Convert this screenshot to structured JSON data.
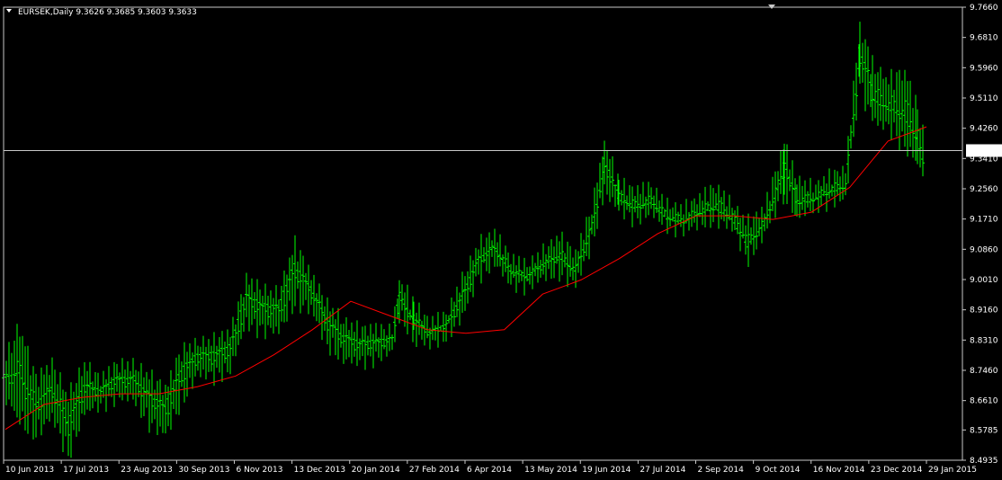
{
  "header": {
    "symbol_timeframe": "EURSEK,Daily",
    "ohlc": "9.3626 9.3685 9.3603 9.3633"
  },
  "colors": {
    "background": "#000000",
    "frame": "#c8c8c8",
    "bars": "#00ff00",
    "moving_average": "#ff0000",
    "price_line": "#c8c8c8",
    "price_label_bg": "#ffffff",
    "price_label_text": "#000000"
  },
  "chart_data": {
    "type": "bar",
    "ylim": [
      8.4935,
      9.766
    ],
    "yticks": [
      "9.7660",
      "9.6810",
      "9.5960",
      "9.5110",
      "9.4260",
      "9.3410",
      "9.2560",
      "9.1710",
      "9.0860",
      "9.0010",
      "8.9160",
      "8.8310",
      "8.7460",
      "8.6610",
      "8.5785",
      "8.4935"
    ],
    "xticks": [
      "10 Jun 2013",
      "17 Jul 2013",
      "23 Aug 2013",
      "30 Sep 2013",
      "6 Nov 2013",
      "13 Dec 2013",
      "20 Jan 2014",
      "27 Feb 2014",
      "6 Apr 2014",
      "13 May 2014",
      "19 Jun 2014",
      "27 Jul 2014",
      "2 Sep 2014",
      "9 Oct 2014",
      "16 Nov 2014",
      "23 Dec 2014",
      "29 Jan 2015"
    ],
    "current_price": "9.3633",
    "current_price_value": 9.3633,
    "series": [
      {
        "type": "ohlc",
        "points": [
          {
            "i": 0,
            "low": 8.68,
            "high": 8.77
          },
          {
            "i": 18,
            "low": 8.61,
            "high": 8.86
          },
          {
            "i": 36,
            "low": 8.57,
            "high": 8.72
          },
          {
            "i": 54,
            "low": 8.62,
            "high": 8.76
          },
          {
            "i": 72,
            "low": 8.51,
            "high": 8.67
          },
          {
            "i": 90,
            "low": 8.63,
            "high": 8.76
          },
          {
            "i": 108,
            "low": 8.65,
            "high": 8.72
          },
          {
            "i": 126,
            "low": 8.67,
            "high": 8.76
          },
          {
            "i": 144,
            "low": 8.67,
            "high": 8.76
          },
          {
            "i": 162,
            "low": 8.6,
            "high": 8.73
          },
          {
            "i": 180,
            "low": 8.57,
            "high": 8.69
          },
          {
            "i": 198,
            "low": 8.66,
            "high": 8.8
          },
          {
            "i": 216,
            "low": 8.74,
            "high": 8.82
          },
          {
            "i": 234,
            "low": 8.73,
            "high": 8.83
          },
          {
            "i": 252,
            "low": 8.75,
            "high": 8.85
          },
          {
            "i": 270,
            "low": 8.88,
            "high": 9.0
          },
          {
            "i": 288,
            "low": 8.86,
            "high": 8.97
          },
          {
            "i": 306,
            "low": 8.86,
            "high": 8.96
          },
          {
            "i": 324,
            "low": 8.94,
            "high": 9.1
          },
          {
            "i": 342,
            "low": 8.92,
            "high": 9.01
          },
          {
            "i": 360,
            "low": 8.82,
            "high": 8.93
          },
          {
            "i": 378,
            "low": 8.78,
            "high": 8.88
          },
          {
            "i": 396,
            "low": 8.77,
            "high": 8.86
          },
          {
            "i": 414,
            "low": 8.78,
            "high": 8.86
          },
          {
            "i": 432,
            "low": 8.8,
            "high": 8.86
          },
          {
            "i": 440,
            "low": 8.9,
            "high": 9.0
          },
          {
            "i": 456,
            "low": 8.84,
            "high": 8.93
          },
          {
            "i": 474,
            "low": 8.82,
            "high": 8.88
          },
          {
            "i": 492,
            "low": 8.84,
            "high": 8.9
          },
          {
            "i": 510,
            "low": 8.9,
            "high": 9.0
          },
          {
            "i": 528,
            "low": 9.01,
            "high": 9.1
          },
          {
            "i": 546,
            "low": 9.05,
            "high": 9.13
          },
          {
            "i": 564,
            "low": 8.99,
            "high": 9.06
          },
          {
            "i": 582,
            "low": 8.98,
            "high": 9.04
          },
          {
            "i": 600,
            "low": 9.01,
            "high": 9.08
          },
          {
            "i": 618,
            "low": 9.02,
            "high": 9.12
          },
          {
            "i": 636,
            "low": 8.99,
            "high": 9.07
          },
          {
            "i": 654,
            "low": 9.1,
            "high": 9.2
          },
          {
            "i": 668,
            "low": 9.25,
            "high": 9.39
          },
          {
            "i": 684,
            "low": 9.2,
            "high": 9.27
          },
          {
            "i": 702,
            "low": 9.17,
            "high": 9.25
          },
          {
            "i": 720,
            "low": 9.19,
            "high": 9.26
          },
          {
            "i": 738,
            "low": 9.15,
            "high": 9.21
          },
          {
            "i": 756,
            "low": 9.14,
            "high": 9.2
          },
          {
            "i": 774,
            "low": 9.16,
            "high": 9.23
          },
          {
            "i": 792,
            "low": 9.17,
            "high": 9.26
          },
          {
            "i": 810,
            "low": 9.15,
            "high": 9.21
          },
          {
            "i": 828,
            "low": 9.06,
            "high": 9.16
          },
          {
            "i": 846,
            "low": 9.13,
            "high": 9.2
          },
          {
            "i": 868,
            "low": 9.25,
            "high": 9.38
          },
          {
            "i": 882,
            "low": 9.18,
            "high": 9.28
          },
          {
            "i": 900,
            "low": 9.2,
            "high": 9.26
          },
          {
            "i": 918,
            "low": 9.22,
            "high": 9.29
          },
          {
            "i": 936,
            "low": 9.23,
            "high": 9.31
          },
          {
            "i": 952,
            "low": 9.55,
            "high": 9.71
          },
          {
            "i": 966,
            "low": 9.45,
            "high": 9.6
          },
          {
            "i": 984,
            "low": 9.43,
            "high": 9.56
          },
          {
            "i": 1002,
            "low": 9.38,
            "high": 9.58
          },
          {
            "i": 1016,
            "low": 9.33,
            "high": 9.48
          },
          {
            "i": 1024,
            "low": 9.28,
            "high": 9.38
          }
        ]
      },
      {
        "type": "moving_average",
        "points": [
          8.58,
          8.65,
          8.67,
          8.68,
          8.68,
          8.7,
          8.73,
          8.79,
          8.86,
          8.94,
          8.9,
          8.86,
          8.85,
          8.86,
          8.96,
          9.0,
          9.06,
          9.13,
          9.18,
          9.18,
          9.17,
          9.19,
          9.26,
          9.39,
          9.43
        ]
      }
    ]
  }
}
